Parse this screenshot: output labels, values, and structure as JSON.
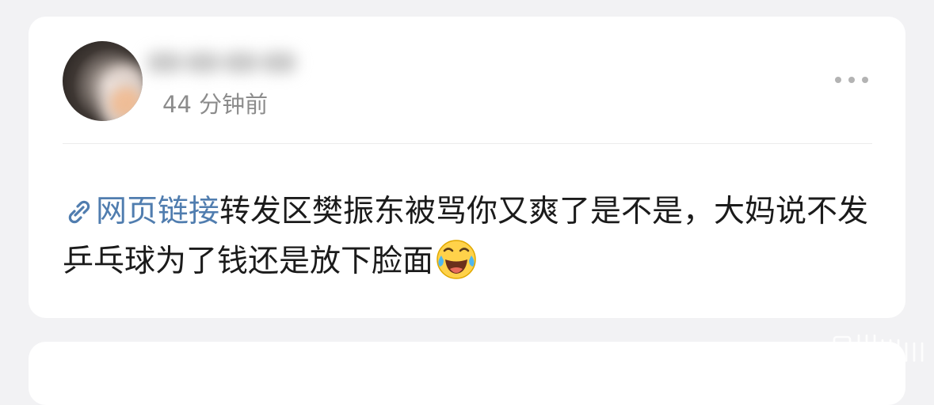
{
  "post": {
    "timestamp": "44 分钟前",
    "link_label": "网页链接",
    "content": "转发区樊振东被骂你又爽了是不是，大妈说不发乒乓球为了钱还是放下脸面",
    "link_icon": "link-icon",
    "emoji": "laughing-crying-emoji",
    "more_icon": "more-horizontal-icon"
  },
  "colors": {
    "page_background": "#f2f2f4",
    "card_background": "#ffffff",
    "link": "#507daf",
    "text": "#1b1b1b",
    "timestamp": "#8c8c8c"
  }
}
